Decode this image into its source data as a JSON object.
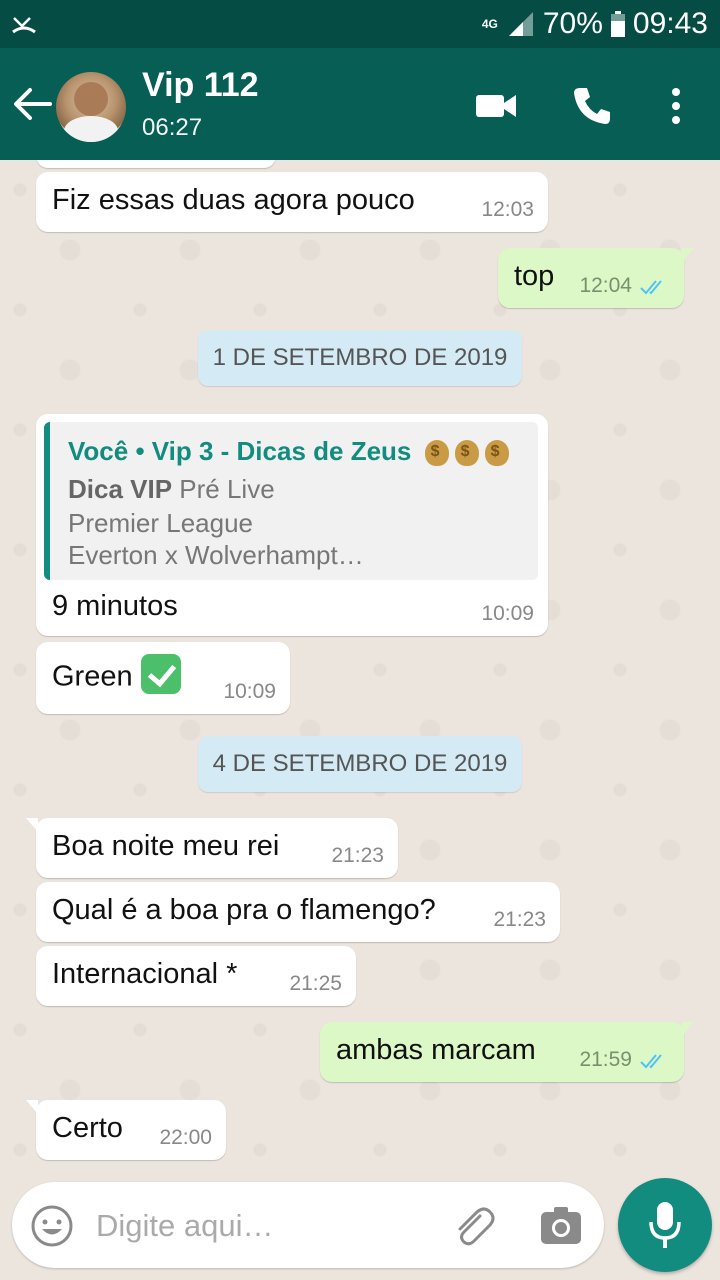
{
  "status_bar": {
    "network": "4G",
    "battery": "70%",
    "time": "09:43"
  },
  "header": {
    "contact_name": "Vip 112",
    "subtitle": "06:27"
  },
  "messages": [
    {
      "direction": "in",
      "text": "Fiz essas duas agora pouco",
      "time": "12:03"
    },
    {
      "direction": "out",
      "text": "top",
      "time": "12:04",
      "ticks": "read"
    },
    {
      "type": "date",
      "text": "1 DE SETEMBRO DE 2019"
    },
    {
      "direction": "in",
      "quote": {
        "title": "Você • Vip 3 - Dicas de Zeus",
        "title_emoji": "money-bag x3",
        "line1_bold": "Dica VIP",
        "line1_rest": " Pré Live",
        "line2": "Premier League",
        "line3": "Everton x Wolverhampt…"
      },
      "text": "9 minutos",
      "time": "10:09"
    },
    {
      "direction": "in",
      "text": "Green",
      "emoji": "check-mark-button",
      "time": "10:09"
    },
    {
      "type": "date",
      "text": "4 DE SETEMBRO DE 2019"
    },
    {
      "direction": "in",
      "text": "Boa noite meu rei",
      "time": "21:23"
    },
    {
      "direction": "in",
      "text": "Qual é a boa pra o flamengo?",
      "time": "21:23"
    },
    {
      "direction": "in",
      "text": "Internacional *",
      "time": "21:25"
    },
    {
      "direction": "out",
      "text": "ambas marcam",
      "time": "21:59",
      "ticks": "read"
    },
    {
      "direction": "in",
      "text": "Certo",
      "time": "22:00"
    }
  ],
  "composer": {
    "placeholder": "Digite aqui…",
    "value": ""
  },
  "colors": {
    "header": "#075e54",
    "status_bar": "#054d44",
    "outgoing_bubble": "#dcf8c6",
    "incoming_bubble": "#ffffff",
    "read_ticks": "#4fc3f7",
    "accent": "#128c7e"
  }
}
